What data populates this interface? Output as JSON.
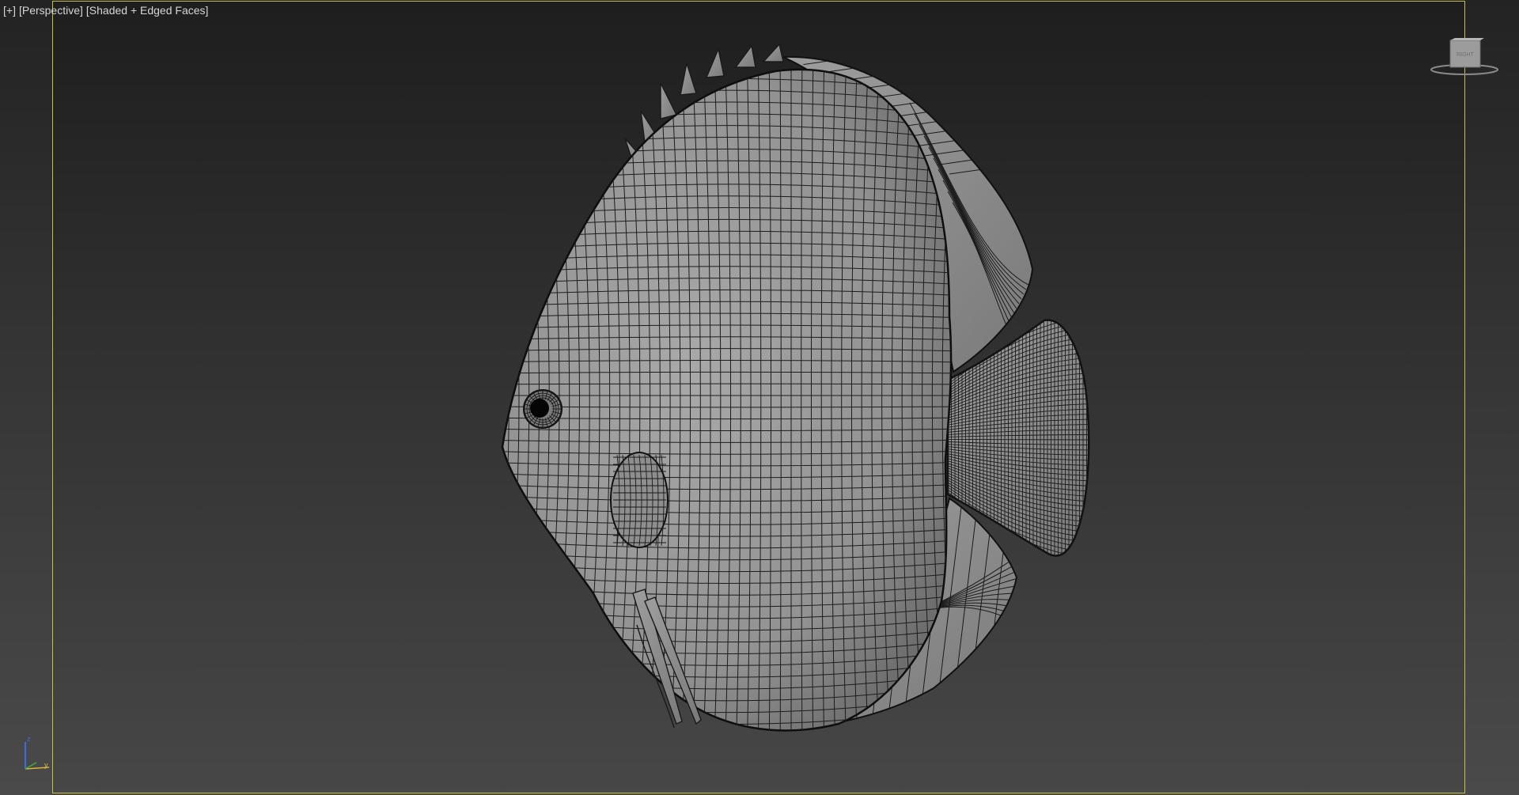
{
  "viewport": {
    "label_parts": [
      "[+]",
      "[Perspective]",
      "[Shaded + Edged Faces]"
    ],
    "frame_color": "#c7c23a",
    "model_fill": "#9a9a9a",
    "wire_color": "#1a1a1a"
  },
  "viewcube": {
    "label": "RIGHT",
    "icon": "viewcube-icon"
  },
  "axis_tripod": {
    "z_label": "z",
    "y_label": "y",
    "icon": "axis-tripod-icon"
  }
}
